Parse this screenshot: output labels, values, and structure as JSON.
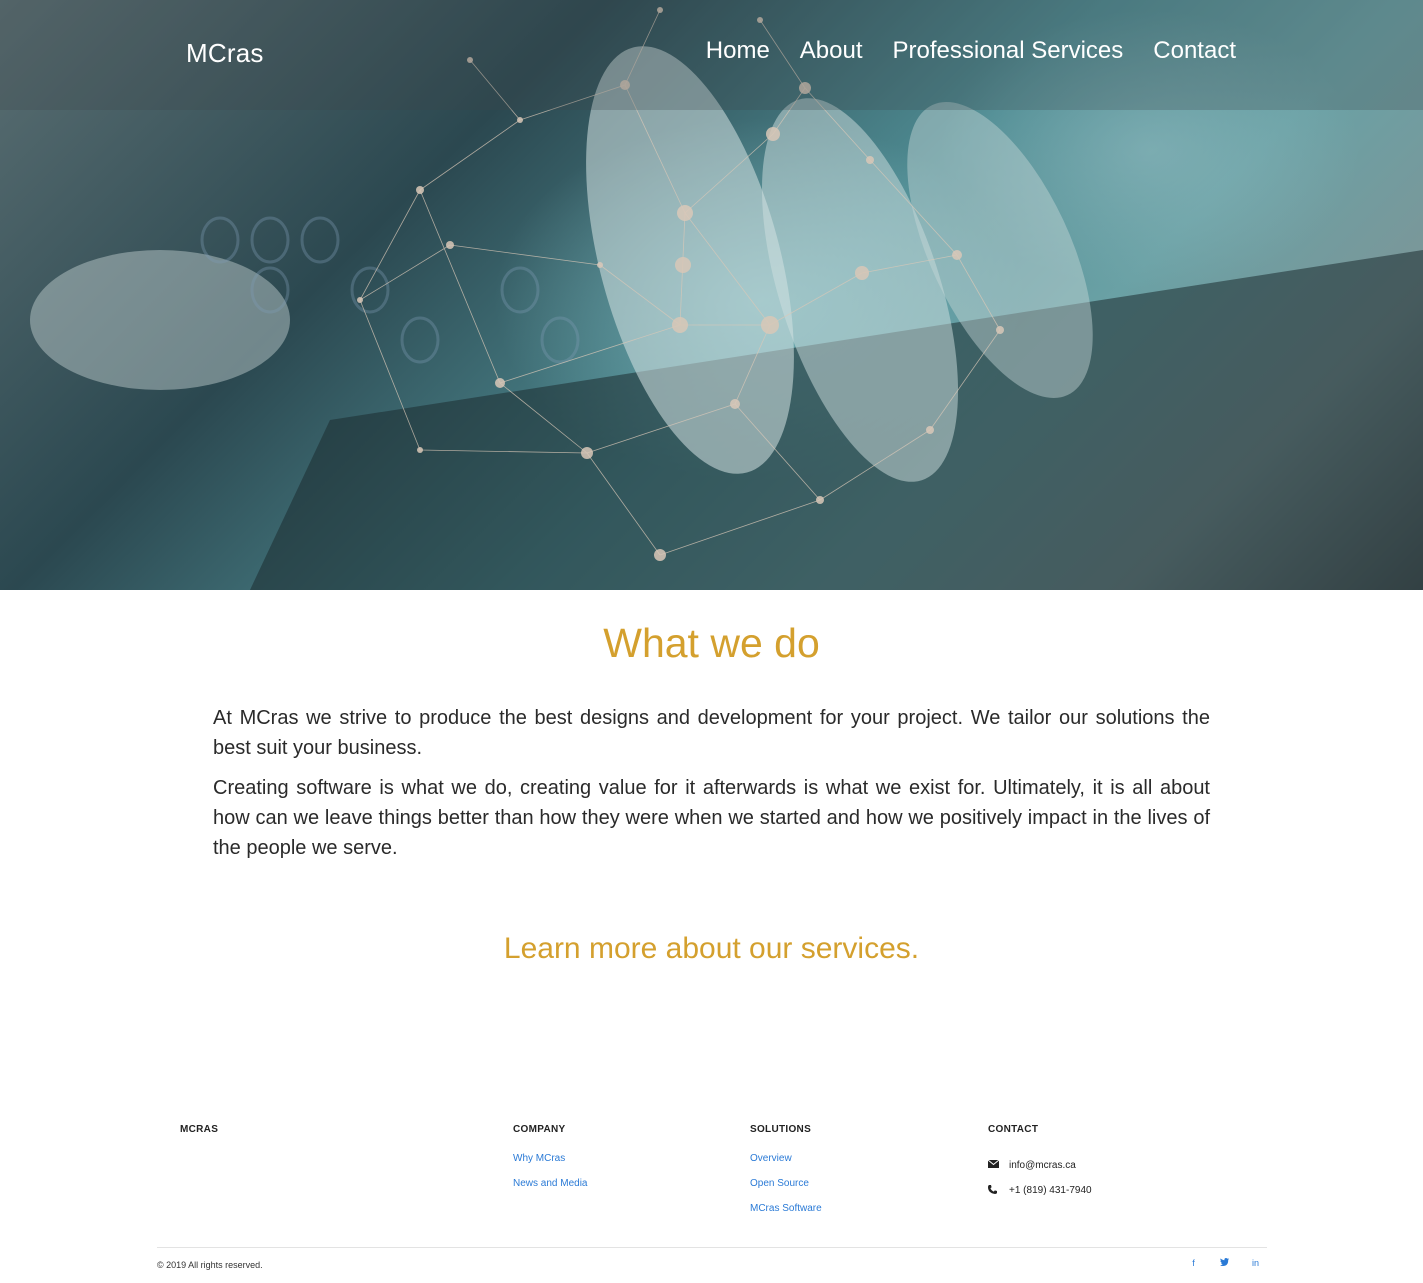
{
  "header": {
    "brand": "MCras",
    "nav": [
      "Home",
      "About",
      "Professional Services",
      "Contact"
    ]
  },
  "main": {
    "title": "What we do",
    "paragraphs": [
      "At MCras we strive to produce the best designs and development for your project. We tailor our solutions the best suit your business.",
      "Creating software is what we do, creating value for it afterwards is what we exist for. Ultimately, it is all about how can we leave things better than how they were when we started and how we positively impact in the lives of the people we serve."
    ],
    "cta": "Learn more about our services."
  },
  "footer": {
    "brand_heading": "MCRAS",
    "company": {
      "heading": "COMPANY",
      "links": [
        "Why MCras",
        "News and Media"
      ]
    },
    "solutions": {
      "heading": "SOLUTIONS",
      "links": [
        "Overview",
        "Open Source",
        "MCras Software"
      ]
    },
    "contact": {
      "heading": "CONTACT",
      "email": "info@mcras.ca",
      "phone": "+1 (819) 431-7940"
    },
    "copyright": "© 2019 All rights reserved.",
    "social": {
      "facebook": "f",
      "twitter": "t",
      "linkedin": "in"
    },
    "icons": {
      "email": "envelope-icon",
      "phone": "phone-icon"
    }
  },
  "colors": {
    "accent": "#d4a02e",
    "link": "#2a7ad6",
    "nav_text": "#ffffff"
  }
}
